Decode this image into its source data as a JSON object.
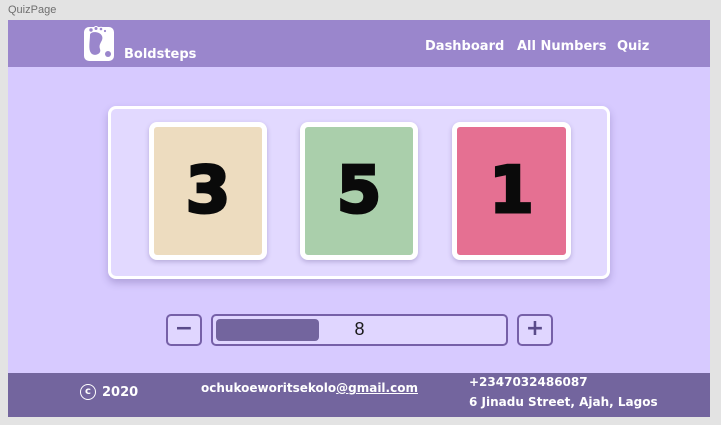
{
  "frame_title": "QuizPage",
  "header": {
    "brand": "Boldsteps",
    "logo_icon": "footprint-logo-icon",
    "nav": [
      {
        "label": "Dashboard"
      },
      {
        "label": "All Numbers"
      },
      {
        "label": "Quiz"
      }
    ]
  },
  "cards": [
    {
      "value": "3",
      "color": "#eddcbf"
    },
    {
      "value": "5",
      "color": "#aacfab"
    },
    {
      "value": "1",
      "color": "#e57092"
    }
  ],
  "stepper": {
    "minus_label": "−",
    "plus_label": "+",
    "value": "8",
    "fill_fraction": 0.36
  },
  "footer": {
    "copyright_symbol": "c",
    "year": "2020",
    "email_user": "ochukoeworitsekolo",
    "email_domain": "@gmail.com",
    "phone": "+2347032486087",
    "address": "6 Jinadu Street, Ajah, Lagos"
  },
  "colors": {
    "navbar": "#9a86cc",
    "page_bg": "#d7caff",
    "footer": "#73659e",
    "accent_border": "#7660a8"
  }
}
